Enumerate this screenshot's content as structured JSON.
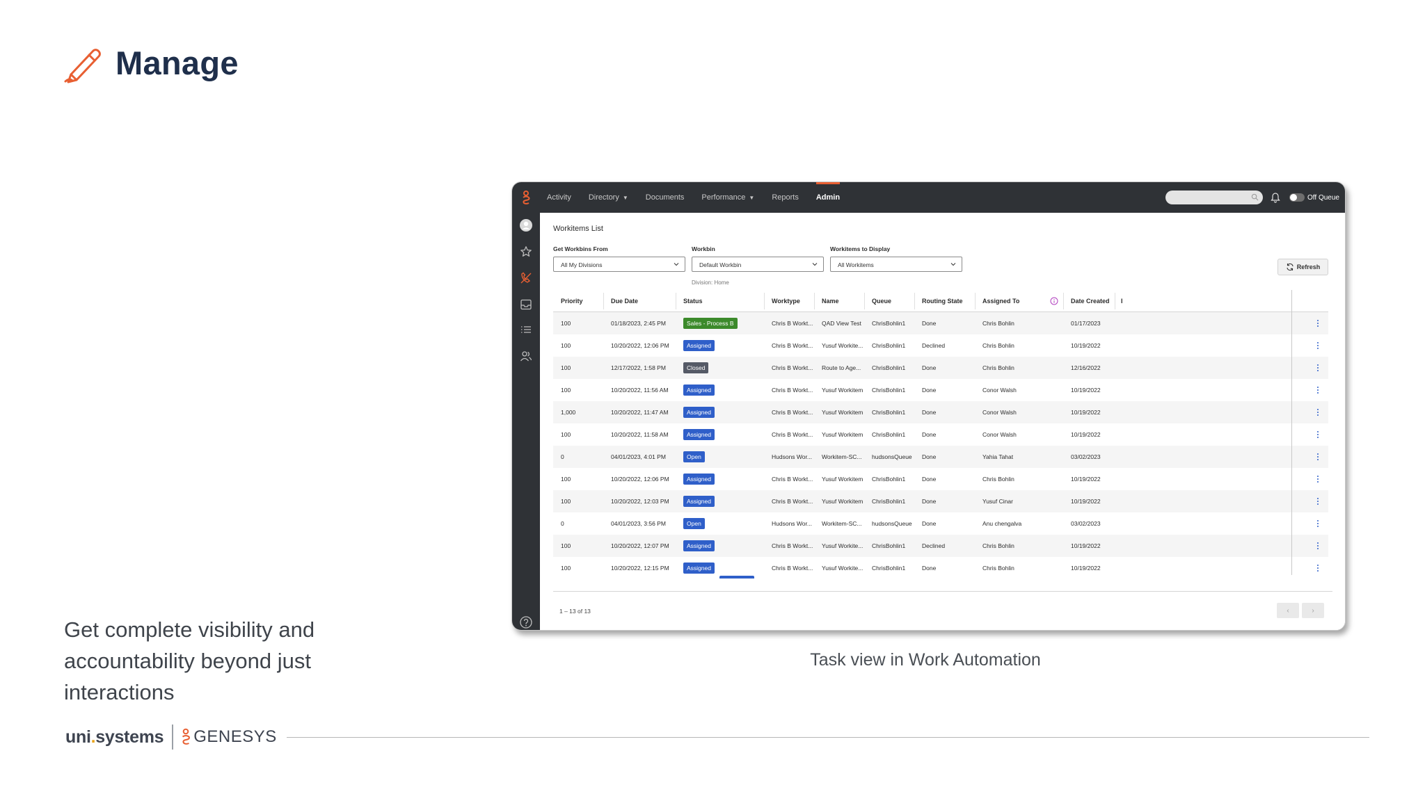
{
  "slide": {
    "title": "Manage",
    "lead": "Get complete visibility and accountability beyond just interactions",
    "caption": "Task view in Work Automation",
    "accent_color": "#e85f32",
    "title_color": "#1f2f4b",
    "icon": "pencil-icon"
  },
  "footer": {
    "uni_prefix": "uni",
    "uni_dot": ".",
    "uni_suffix": "systems",
    "genesys": "GENESYS"
  },
  "app": {
    "nav": {
      "activity": "Activity",
      "directory": "Directory",
      "documents": "Documents",
      "performance": "Performance",
      "reports": "Reports",
      "admin": "Admin"
    },
    "off_queue": "Off Queue",
    "workitems_title": "Workitems List",
    "filters": {
      "workbins_from_label": "Get Workbins From",
      "workbins_from_value": "All My Divisions",
      "workbin_label": "Workbin",
      "workbin_value": "Default Workbin",
      "display_label": "Workitems to Display",
      "display_value": "All Workitems",
      "division_note": "Division: Home"
    },
    "refresh": "Refresh",
    "columns": {
      "priority": "Priority",
      "due_date": "Due Date",
      "status": "Status",
      "worktype": "Worktype",
      "name": "Name",
      "queue": "Queue",
      "routing_state": "Routing State",
      "assigned_to": "Assigned To",
      "date_created": "Date Created",
      "more": "I"
    },
    "rows": [
      {
        "priority": "100",
        "due": "01/18/2023, 2:45 PM",
        "status": "Sales - Process B",
        "status_color": "green",
        "worktype": "Chris B Workt...",
        "name": "QAD View Test",
        "queue": "ChrisBohlin1",
        "routing": "Done",
        "assigned": "Chris Bohlin",
        "created": "01/17/2023"
      },
      {
        "priority": "100",
        "due": "10/20/2022, 12:06 PM",
        "status": "Assigned",
        "status_color": "blue",
        "worktype": "Chris B Workt...",
        "name": "Yusuf Workite...",
        "queue": "ChrisBohlin1",
        "routing": "Declined",
        "assigned": "Chris Bohlin",
        "created": "10/19/2022"
      },
      {
        "priority": "100",
        "due": "12/17/2022, 1:58 PM",
        "status": "Closed",
        "status_color": "gray",
        "worktype": "Chris B Workt...",
        "name": "Route to Age...",
        "queue": "ChrisBohlin1",
        "routing": "Done",
        "assigned": "Chris Bohlin",
        "created": "12/16/2022"
      },
      {
        "priority": "100",
        "due": "10/20/2022, 11:56 AM",
        "status": "Assigned",
        "status_color": "blue",
        "worktype": "Chris B Workt...",
        "name": "Yusuf Workitem",
        "queue": "ChrisBohlin1",
        "routing": "Done",
        "assigned": "Conor Walsh",
        "created": "10/19/2022"
      },
      {
        "priority": "1,000",
        "due": "10/20/2022, 11:47 AM",
        "status": "Assigned",
        "status_color": "blue",
        "worktype": "Chris B Workt...",
        "name": "Yusuf Workitem",
        "queue": "ChrisBohlin1",
        "routing": "Done",
        "assigned": "Conor Walsh",
        "created": "10/19/2022"
      },
      {
        "priority": "100",
        "due": "10/20/2022, 11:58 AM",
        "status": "Assigned",
        "status_color": "blue",
        "worktype": "Chris B Workt...",
        "name": "Yusuf Workitem",
        "queue": "ChrisBohlin1",
        "routing": "Done",
        "assigned": "Conor Walsh",
        "created": "10/19/2022"
      },
      {
        "priority": "0",
        "due": "04/01/2023, 4:01 PM",
        "status": "Open",
        "status_color": "blue",
        "worktype": "Hudsons Wor...",
        "name": "Workitem-SC...",
        "queue": "hudsonsQueue",
        "routing": "Done",
        "assigned": "Yahia Tahat",
        "created": "03/02/2023"
      },
      {
        "priority": "100",
        "due": "10/20/2022, 12:06 PM",
        "status": "Assigned",
        "status_color": "blue",
        "worktype": "Chris B Workt...",
        "name": "Yusuf Workitem",
        "queue": "ChrisBohlin1",
        "routing": "Done",
        "assigned": "Chris Bohlin",
        "created": "10/19/2022"
      },
      {
        "priority": "100",
        "due": "10/20/2022, 12:03 PM",
        "status": "Assigned",
        "status_color": "blue",
        "worktype": "Chris B Workt...",
        "name": "Yusuf Workitem",
        "queue": "ChrisBohlin1",
        "routing": "Done",
        "assigned": "Yusuf Cinar",
        "created": "10/19/2022"
      },
      {
        "priority": "0",
        "due": "04/01/2023, 3:56 PM",
        "status": "Open",
        "status_color": "blue",
        "worktype": "Hudsons Wor...",
        "name": "Workitem-SC...",
        "queue": "hudsonsQueue",
        "routing": "Done",
        "assigned": "Anu chengalva",
        "created": "03/02/2023"
      },
      {
        "priority": "100",
        "due": "10/20/2022, 12:07 PM",
        "status": "Assigned",
        "status_color": "blue",
        "worktype": "Chris B Workt...",
        "name": "Yusuf Workite...",
        "queue": "ChrisBohlin1",
        "routing": "Declined",
        "assigned": "Chris Bohlin",
        "created": "10/19/2022"
      },
      {
        "priority": "100",
        "due": "10/20/2022, 12:15 PM",
        "status": "Assigned",
        "status_color": "blue",
        "worktype": "Chris B Workt...",
        "name": "Yusuf Workite...",
        "queue": "ChrisBohlin1",
        "routing": "Done",
        "assigned": "Chris Bohlin",
        "created": "10/19/2022"
      }
    ],
    "pager_text": "1 – 13 of 13",
    "pager_prev": "‹",
    "pager_next": "›"
  }
}
